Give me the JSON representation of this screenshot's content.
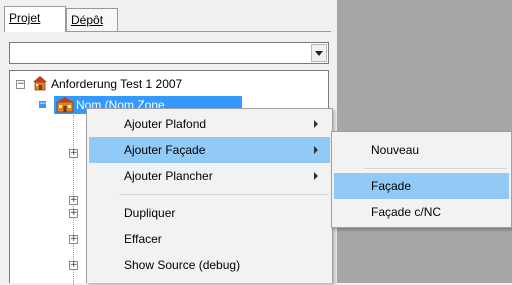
{
  "tabs": [
    {
      "label": "Projet"
    },
    {
      "label": "Dépôt"
    }
  ],
  "combo": {
    "value": ""
  },
  "tree": {
    "root": {
      "label": "Anforderung Test 1 2007",
      "icon": "house-icon",
      "expander": "−"
    },
    "selected": {
      "label": "Nom (Nom Zone",
      "icon": "building-icon",
      "expander": "−"
    },
    "children_expander": "+"
  },
  "context_menu": {
    "items": [
      {
        "label": "Ajouter Plafond",
        "submenu": true
      },
      {
        "label": "Ajouter Façade",
        "submenu": true,
        "highlighted": true
      },
      {
        "label": "Ajouter Plancher",
        "submenu": true
      },
      {
        "label": "Dupliquer"
      },
      {
        "label": "Effacer"
      },
      {
        "label": "Show Source (debug)"
      }
    ]
  },
  "submenu": {
    "items": [
      {
        "label": "Nouveau"
      },
      {
        "label": "Façade",
        "highlighted": true
      },
      {
        "label": "Façade c/NC"
      }
    ]
  },
  "colors": {
    "selection": "#3399ff",
    "menu_highlight": "#91c9f7",
    "right_panel": "#a6a6a6"
  }
}
